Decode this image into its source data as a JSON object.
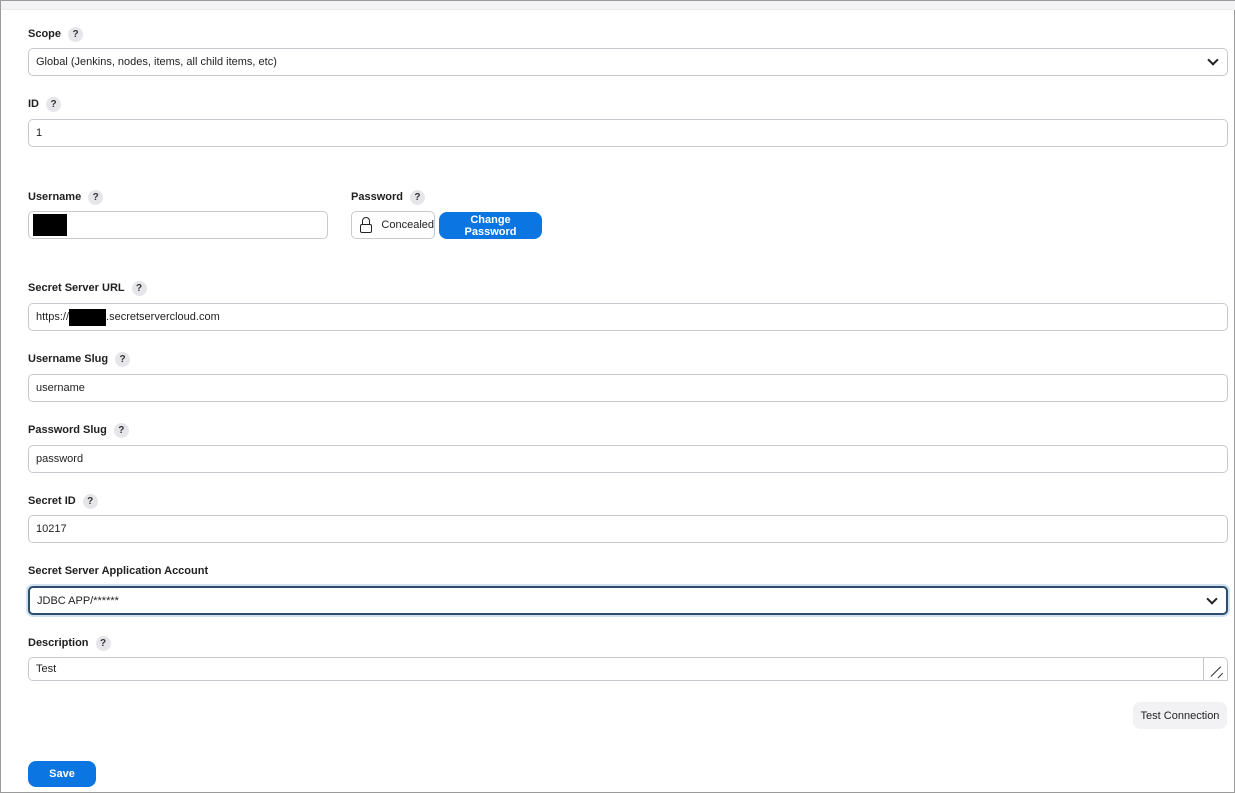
{
  "form": {
    "scope": {
      "label": "Scope",
      "value": "Global (Jenkins, nodes, items, all child items, etc)"
    },
    "id": {
      "label": "ID",
      "value": "1"
    },
    "username": {
      "label": "Username"
    },
    "password": {
      "label": "Password",
      "status": "Concealed",
      "change_label": "Change Password"
    },
    "secret_server_url": {
      "label": "Secret Server URL",
      "prefix": "https://",
      "suffix": ".secretservercloud.com"
    },
    "username_slug": {
      "label": "Username Slug",
      "value": "username"
    },
    "password_slug": {
      "label": "Password Slug",
      "value": "password"
    },
    "secret_id": {
      "label": "Secret ID",
      "value": "10217"
    },
    "application_account": {
      "label": "Secret Server Application Account",
      "value": "JDBC APP/******"
    },
    "description": {
      "label": "Description",
      "value": "Test"
    },
    "help_glyph": "?",
    "test_connection_label": "Test Connection",
    "save_label": "Save"
  },
  "colors": {
    "primary": "#0b75e1",
    "focus_border": "#2c4e6c",
    "field_border": "#c8c8ce"
  },
  "icons": [
    "help-icon",
    "chevron-down-icon",
    "lock-icon",
    "resize-grip-icon"
  ]
}
